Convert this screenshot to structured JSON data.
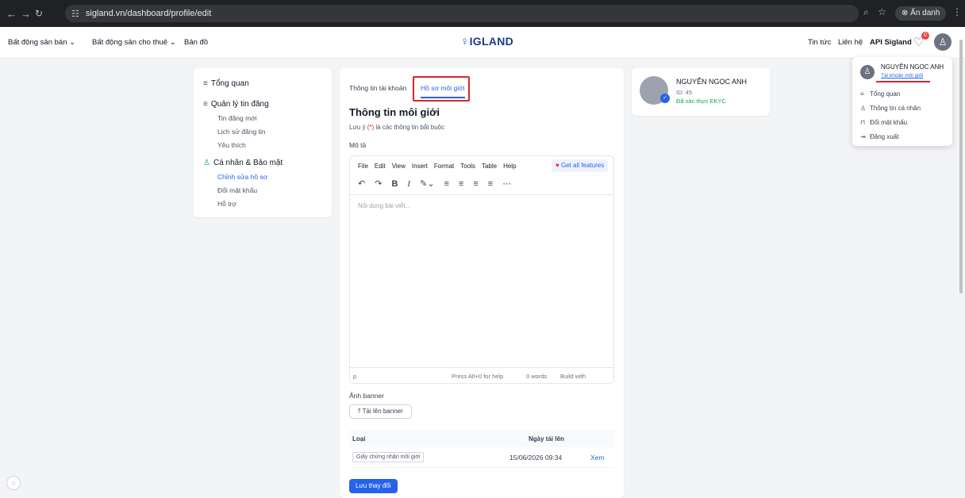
{
  "browser": {
    "url": "sigland.vn/dashboard/profile/edit",
    "incognito_label": "Ẩn danh"
  },
  "topnav": {
    "left_items": [
      "Bất động sản bán",
      "Bất động sản cho thuê",
      "Bản đồ"
    ],
    "logo": "IGLAND",
    "right_items": [
      "Tin tức",
      "Liên hệ",
      "API Sigland"
    ],
    "notification_count": "0"
  },
  "sidebar": {
    "overview": "Tổng quan",
    "listing_mgmt": "Quản lý tin đăng",
    "listing_items": [
      "Tin đăng mới",
      "Lịch sử đăng tin",
      "Yêu thích"
    ],
    "personal_security": "Cá nhân & Bảo mật",
    "personal_items": [
      "Chỉnh sửa hồ sơ",
      "Đổi mật khẩu",
      "Hỗ trợ"
    ]
  },
  "main": {
    "tabs": [
      "Thông tin tài khoản",
      "Hồ sơ môi giới"
    ],
    "title": "Thông tin môi giới",
    "note_prefix": "Lưu ý",
    "note_required": "(*)",
    "note_suffix": "là các thông tin bắt buộc",
    "description_label": "Mô tả",
    "editor": {
      "menu": [
        "File",
        "Edit",
        "View",
        "Insert",
        "Format",
        "Tools",
        "Table",
        "Help"
      ],
      "get_all_features": "Get all features",
      "placeholder": "Nội dung bài viết...",
      "status_path": "p",
      "status_help": "Press Alt+0 for help",
      "status_words": "0 words",
      "status_build": "Build with"
    },
    "banner_label": "Ảnh banner",
    "upload_label": "Tải lên banner",
    "table": {
      "headers": [
        "Loại",
        "Ngày tải lên"
      ],
      "rows": [
        {
          "type": "Giấy chứng nhận môi giới",
          "date": "15/06/2026 09:34",
          "action": "Xem"
        }
      ]
    },
    "save_label": "Lưu thay đổi"
  },
  "profile": {
    "name": "NGUYỄN NGỌC ANH",
    "id": "ID: 45",
    "ekyc": "Đã xác thực EKYC"
  },
  "dropdown": {
    "name": "NGUYỄN NGỌC ANH",
    "account_type": "Tài khoản môi giới",
    "items": [
      "Tổng quan",
      "Thông tin cá nhân",
      "Đổi mật khẩu",
      "Đăng xuất"
    ]
  }
}
